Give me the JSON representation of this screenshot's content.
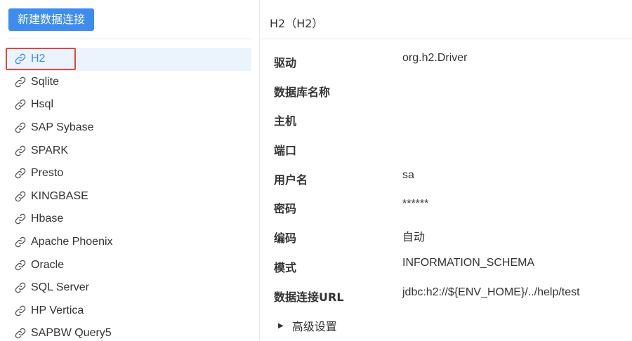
{
  "left": {
    "new_button_label": "新建数据连接",
    "connections": [
      {
        "label": "H2"
      },
      {
        "label": "Sqlite"
      },
      {
        "label": "Hsql"
      },
      {
        "label": "SAP Sybase"
      },
      {
        "label": "SPARK"
      },
      {
        "label": "Presto"
      },
      {
        "label": "KINGBASE"
      },
      {
        "label": "Hbase"
      },
      {
        "label": "Apache Phoenix"
      },
      {
        "label": "Oracle"
      },
      {
        "label": "SQL Server"
      },
      {
        "label": "HP Vertica"
      },
      {
        "label": "SAPBW Query5"
      }
    ],
    "selected_index": 0,
    "connection_icon": "link-icon"
  },
  "right": {
    "title": "H2（H2）",
    "fields": [
      {
        "label": "驱动",
        "value": "org.h2.Driver"
      },
      {
        "label": "数据库名称",
        "value": ""
      },
      {
        "label": "主机",
        "value": ""
      },
      {
        "label": "端口",
        "value": ""
      },
      {
        "label": "用户名",
        "value": "sa"
      },
      {
        "label": "密码",
        "value": "******"
      },
      {
        "label": "编码",
        "value": "自动"
      },
      {
        "label": "模式",
        "value": "INFORMATION_SCHEMA"
      },
      {
        "label": "数据连接URL",
        "value": "jdbc:h2://${ENV_HOME}/../help/test"
      }
    ],
    "advanced_label": "高级设置"
  },
  "colors": {
    "accent": "#3d8cee",
    "selected_bg": "#ebf3fd",
    "highlight": "#e0473f"
  }
}
